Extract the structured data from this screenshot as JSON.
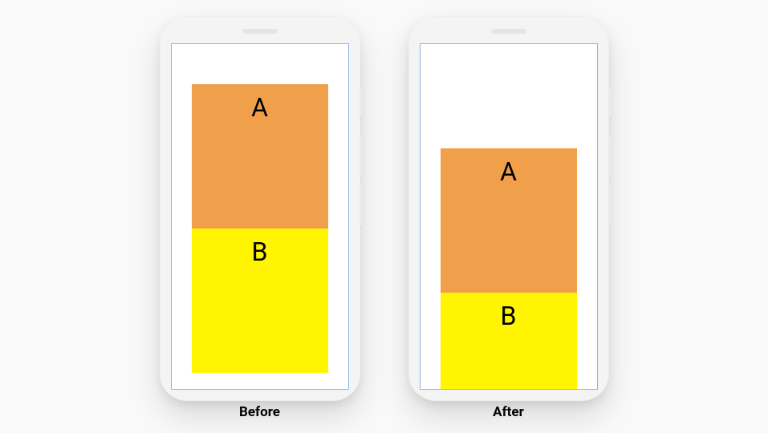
{
  "phones": {
    "before": {
      "caption": "Before",
      "blocks": {
        "a": "A",
        "b": "B"
      }
    },
    "after": {
      "caption": "After",
      "blocks": {
        "a": "A",
        "b": "B"
      }
    }
  },
  "colors": {
    "block_a": "#f0a04b",
    "block_b": "#fff500",
    "screen_border": "#8bb4e8",
    "phone_body": "#f4f4f4",
    "page_bg": "#f9f9f9"
  },
  "concept": "layout-shift-before-after"
}
